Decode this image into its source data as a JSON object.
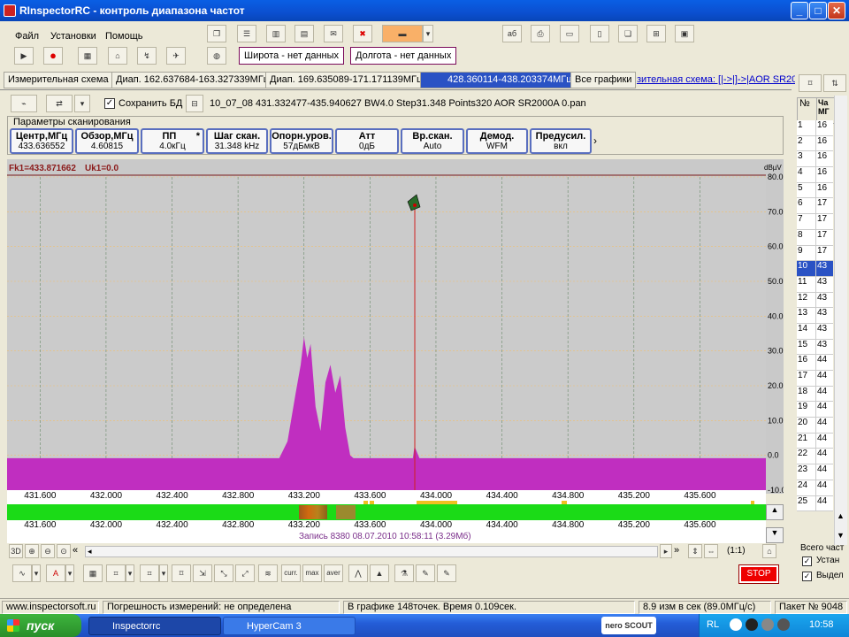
{
  "window": {
    "title": "RInspectorRC - контроль диапазона частот",
    "btn_min": "_",
    "btn_max": "□",
    "btn_close": "✕"
  },
  "menu": {
    "file": "Файл",
    "settings": "Установки",
    "help": "Помощь"
  },
  "toolbar": {
    "lat": "Широта - нет данных",
    "lon": "Долгота - нет данных"
  },
  "tabs": [
    {
      "label": "Измерительная схема"
    },
    {
      "label": "Диап. 162.637684-163.327339МГц"
    },
    {
      "label": "Диап. 169.635089-171.171139МГц"
    },
    {
      "label": "428.360114-438.203374МГц"
    },
    {
      "label": "Все графики"
    }
  ],
  "schema_link": "зительная схема: [|->|]->|AOR SR20",
  "save_db_label": "Сохранить БД",
  "file_info": "10_07_08 431.332477-435.940627 BW4.0 Step31.348 Points320 AOR SR2000A 0.pan",
  "params": {
    "group_title": "Параметры сканирования",
    "items": [
      {
        "title": "Центр,МГц",
        "value": "433.636552"
      },
      {
        "title": "Обзор,МГц",
        "value": "4.60815"
      },
      {
        "title": "ПП",
        "value": "4.0кГц",
        "star": "*"
      },
      {
        "title": "Шаг скан.",
        "value": "31.348 kHz"
      },
      {
        "title": "Опорн.уров.",
        "value": "57дБмкВ"
      },
      {
        "title": "Атт",
        "value": "0дБ"
      },
      {
        "title": "Вр.скан.",
        "value": "Auto"
      },
      {
        "title": "Демод.",
        "value": "WFM"
      },
      {
        "title": "Предусил.",
        "value": "вкл"
      }
    ]
  },
  "chart_header": {
    "marker": "Fk1=433.871662",
    "uk": "Uk1=0.0",
    "unit": "dBµV"
  },
  "chart_data": {
    "type": "area",
    "xlim": [
      431.4,
      436.0
    ],
    "ylim": [
      -10,
      80
    ],
    "yticks": [
      -10,
      0,
      10,
      20,
      30,
      40,
      50,
      60,
      70,
      80
    ],
    "ytick_labels": [
      "-10.0",
      "0.0",
      "10.0",
      "20.0",
      "30.0",
      "40.0",
      "50.0",
      "60.0",
      "70.0",
      "80.0"
    ],
    "xticks": [
      431.6,
      432.0,
      432.4,
      432.8,
      433.2,
      433.6,
      434.0,
      434.4,
      434.8,
      435.2,
      435.6
    ],
    "xtick_labels": [
      "431.600",
      "432.000",
      "432.400",
      "432.800",
      "433.200",
      "433.600",
      "434.000",
      "434.400",
      "434.800",
      "435.200",
      "435.600"
    ],
    "grid": true,
    "marker_x": 433.871662,
    "x": [
      431.4,
      433.0,
      433.05,
      433.1,
      433.15,
      433.18,
      433.2,
      433.22,
      433.24,
      433.27,
      433.3,
      433.33,
      433.36,
      433.39,
      433.42,
      433.45,
      433.48,
      433.5,
      433.53,
      433.6,
      433.8,
      433.86,
      433.87,
      433.9,
      434.0,
      436.0
    ],
    "y": [
      -0.8,
      -0.8,
      -0.8,
      4,
      18,
      26,
      34,
      28,
      32,
      14,
      7,
      21,
      26,
      18,
      23,
      8,
      0,
      -0.8,
      -0.8,
      -0.8,
      -0.8,
      -0.8,
      2.6,
      -0.8,
      -0.8,
      -0.8
    ],
    "color": "#c02ec0"
  },
  "record_line": "Запись 8380 08.07.2010 10:58:11 (3.29Мб)",
  "zoom_label": "(1:1)",
  "stop_label": "STOP",
  "right": {
    "header_no": "№",
    "header_c": "Ча МГ",
    "rows": [
      [
        "1",
        "16"
      ],
      [
        "2",
        "16"
      ],
      [
        "3",
        "16"
      ],
      [
        "4",
        "16"
      ],
      [
        "5",
        "16"
      ],
      [
        "6",
        "17"
      ],
      [
        "7",
        "17"
      ],
      [
        "8",
        "17"
      ],
      [
        "9",
        "17"
      ],
      [
        "10",
        "43"
      ],
      [
        "11",
        "43"
      ],
      [
        "12",
        "43"
      ],
      [
        "13",
        "43"
      ],
      [
        "14",
        "43"
      ],
      [
        "15",
        "43"
      ],
      [
        "16",
        "44"
      ],
      [
        "17",
        "44"
      ],
      [
        "18",
        "44"
      ],
      [
        "19",
        "44"
      ],
      [
        "20",
        "44"
      ],
      [
        "21",
        "44"
      ],
      [
        "22",
        "44"
      ],
      [
        "23",
        "44"
      ],
      [
        "24",
        "44"
      ],
      [
        "25",
        "44"
      ]
    ],
    "selected_index": 9,
    "total_label": "Всего част",
    "cb1": "Устан",
    "cb2": "Выдел"
  },
  "status": {
    "site": "www.inspectorsoft.ru",
    "error": "Погрешность измерений: не определена",
    "points": "В графике 148точек. Время 0.109сек.",
    "rate": "8.9 изм в сек (89.0МГц/с)",
    "packet": "Пакет № 9048"
  },
  "taskbar": {
    "start": "пуск",
    "task1": "Inspectorrc",
    "task2": "HyperCam 3",
    "lang": "RL",
    "clock": "10:58",
    "tray_brand": "nero SCOUT"
  }
}
